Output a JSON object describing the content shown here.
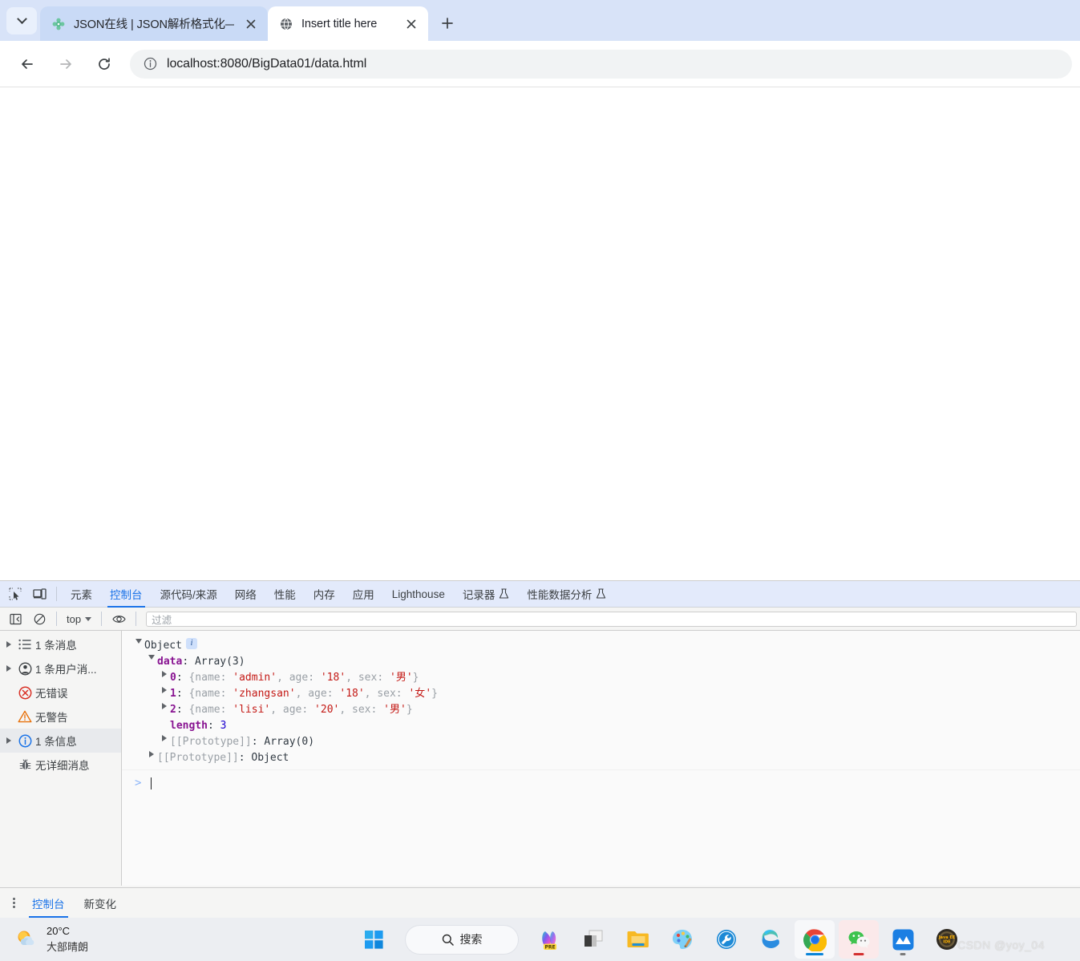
{
  "browser": {
    "tabs": [
      {
        "title": "JSON在线 | JSON解析格式化—",
        "favicon": "puzzle-flower-icon",
        "active": false
      },
      {
        "title": "Insert title here",
        "favicon": "globe-icon",
        "active": true
      }
    ],
    "tab_search_label": "搜索标签页",
    "new_tab_label": "+",
    "toolbar": {
      "back_label": "后退",
      "forward_label": "前进",
      "reload_label": "重新加载",
      "url": "localhost:8080/BigData01/data.html",
      "site_info_label": "查看网站信息"
    }
  },
  "devtools": {
    "tabs": [
      {
        "label": "元素",
        "active": false,
        "beaker": false
      },
      {
        "label": "控制台",
        "active": true,
        "beaker": false
      },
      {
        "label": "源代码/来源",
        "active": false,
        "beaker": false
      },
      {
        "label": "网络",
        "active": false,
        "beaker": false
      },
      {
        "label": "性能",
        "active": false,
        "beaker": false
      },
      {
        "label": "内存",
        "active": false,
        "beaker": false
      },
      {
        "label": "应用",
        "active": false,
        "beaker": false
      },
      {
        "label": "Lighthouse",
        "active": false,
        "beaker": false
      },
      {
        "label": "记录器",
        "active": false,
        "beaker": true
      },
      {
        "label": "性能数据分析",
        "active": false,
        "beaker": true
      }
    ],
    "inspect_icon": "inspect-element-icon",
    "device_icon": "device-toolbar-icon",
    "console_toolbar": {
      "sidebar_toggle_icon": "show-console-sidebar-icon",
      "clear_icon": "clear-console-icon",
      "context": "top",
      "eye_icon": "live-expression-icon",
      "filter_placeholder": "过滤"
    },
    "sidebar": [
      {
        "label": "1 条消息",
        "icon": "list-icon",
        "expandable": true,
        "selected": false
      },
      {
        "label": "1 条用户消...",
        "icon": "user-icon",
        "expandable": true,
        "selected": false
      },
      {
        "label": "无错误",
        "icon": "error-icon",
        "expandable": false,
        "selected": false
      },
      {
        "label": "无警告",
        "icon": "warning-icon",
        "expandable": false,
        "selected": false
      },
      {
        "label": "1 条信息",
        "icon": "info-icon",
        "expandable": true,
        "selected": true
      },
      {
        "label": "无详细消息",
        "icon": "verbose-icon",
        "expandable": false,
        "selected": false
      }
    ],
    "console_output": {
      "root_label": "Object",
      "root_badge": "i",
      "data_key": "data",
      "data_value": "Array(3)",
      "items": [
        {
          "index": "0",
          "preview": "{name: 'admin', age: '18', sex: '男'}",
          "name": "admin",
          "age": "18",
          "sex": "男"
        },
        {
          "index": "1",
          "preview": "{name: 'zhangsan', age: '18', sex: '女'}",
          "name": "zhangsan",
          "age": "18",
          "sex": "女"
        },
        {
          "index": "2",
          "preview": "{name: 'lisi', age: '20', sex: '男'}",
          "name": "lisi",
          "age": "20",
          "sex": "男"
        }
      ],
      "length_key": "length",
      "length_value": "3",
      "proto_array_key": "[[Prototype]]",
      "proto_array_value": "Array(0)",
      "proto_object_key": "[[Prototype]]",
      "proto_object_value": "Object",
      "prompt_symbol": ">"
    },
    "drawer_tabs": [
      {
        "label": "控制台",
        "active": true
      },
      {
        "label": "新变化",
        "active": false
      }
    ]
  },
  "taskbar": {
    "weather": {
      "temp": "20°C",
      "desc": "大部晴朗",
      "icon": "sun-cloud-icon"
    },
    "start_label": "开始",
    "search_label": "搜索",
    "items": [
      {
        "name": "copilot-pre-icon",
        "running": false,
        "badge": "PRE"
      },
      {
        "name": "task-view-icon",
        "running": false
      },
      {
        "name": "file-explorer-icon",
        "running": false
      },
      {
        "name": "paint-icon",
        "running": false
      },
      {
        "name": "tools-icon",
        "running": false
      },
      {
        "name": "edge-icon",
        "running": true
      },
      {
        "name": "chrome-icon",
        "running": true,
        "focused": true
      },
      {
        "name": "wechat-icon",
        "running": true,
        "notify": true
      },
      {
        "name": "mindmaster-icon",
        "running": true
      },
      {
        "name": "javaee-ide-icon",
        "running": false
      }
    ]
  },
  "watermark": "CSDN @yoy_04",
  "colors": {
    "tab_strip": "#d8e3f8",
    "accent": "#1a73e8",
    "devtools_tabbar": "#e3eafb",
    "console_bg": "#fafafa",
    "string_red": "#c41a16",
    "prop_purple": "#881391",
    "number_blue": "#1c00cf",
    "taskbar": "#eceef2"
  }
}
